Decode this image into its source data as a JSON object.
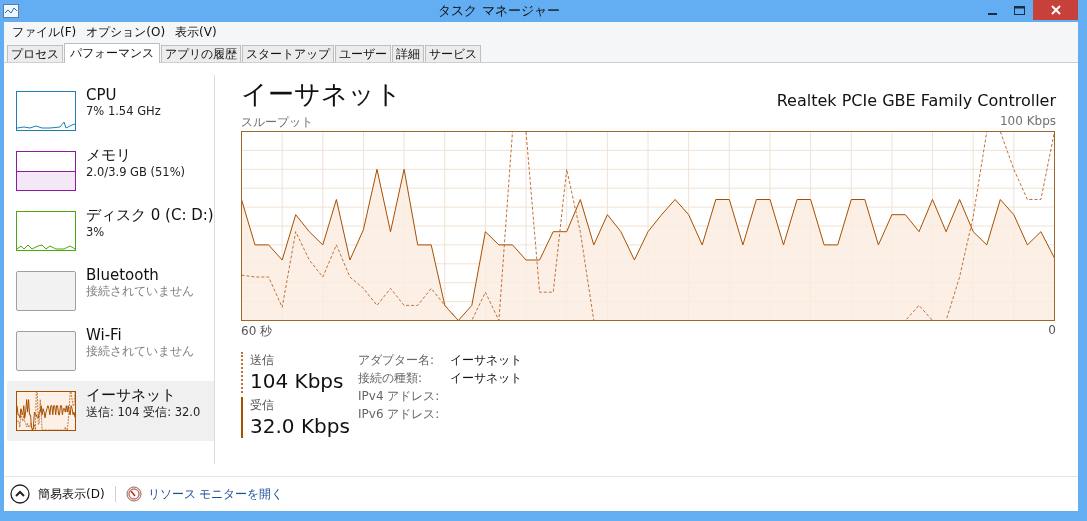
{
  "window": {
    "title": "タスク マネージャー"
  },
  "menu": [
    "ファイル(F)",
    "オプション(O)",
    "表示(V)"
  ],
  "tabs": [
    {
      "label": "プロセス",
      "selected": false
    },
    {
      "label": "パフォーマンス",
      "selected": true
    },
    {
      "label": "アプリの履歴",
      "selected": false
    },
    {
      "label": "スタートアップ",
      "selected": false
    },
    {
      "label": "ユーザー",
      "selected": false
    },
    {
      "label": "詳細",
      "selected": false
    },
    {
      "label": "サービス",
      "selected": false
    }
  ],
  "sidebar": {
    "items": [
      {
        "kind": "cpu",
        "name": "CPU",
        "detail": "7% 1.54 GHz",
        "dimmed": false,
        "selected": false,
        "color": "#1f7fb0"
      },
      {
        "kind": "memory",
        "name": "メモリ",
        "detail": "2.0/3.9 GB (51%)",
        "dimmed": false,
        "selected": false,
        "color": "#8b1aa0"
      },
      {
        "kind": "disk",
        "name": "ディスク 0 (C: D:)",
        "detail": "3%",
        "dimmed": false,
        "selected": false,
        "color": "#4da60c"
      },
      {
        "kind": "empty",
        "name": "Bluetooth",
        "detail": "接続されていません",
        "dimmed": true,
        "selected": false,
        "color": "#a0a0a0"
      },
      {
        "kind": "empty",
        "name": "Wi-Fi",
        "detail": "接続されていません",
        "dimmed": true,
        "selected": false,
        "color": "#a0a0a0"
      },
      {
        "kind": "network",
        "name": "イーサネット",
        "detail": "送信: 104 受信: 32.0",
        "dimmed": false,
        "selected": true,
        "color": "#a74f01"
      }
    ]
  },
  "main": {
    "title": "イーサネット",
    "device": "Realtek PCIe GBE Family Controller",
    "graph": {
      "label": "スループット",
      "max": "100 Kbps",
      "start": "60 秒",
      "end": "0"
    },
    "stats": [
      {
        "kind": "dashed",
        "label": "送信",
        "value": "104 Kbps"
      },
      {
        "kind": "solid",
        "label": "受信",
        "value": "32.0 Kbps"
      }
    ],
    "properties": [
      {
        "label": "アダプター名:",
        "value": "イーサネット"
      },
      {
        "label": "接続の種類:",
        "value": "イーサネット"
      },
      {
        "label": "IPv4 アドレス:"
      },
      {
        "label": "IPv6 アドレス:"
      }
    ]
  },
  "footer": {
    "toggle": "簡易表示(D)",
    "link": "リソース モニターを開く"
  }
}
